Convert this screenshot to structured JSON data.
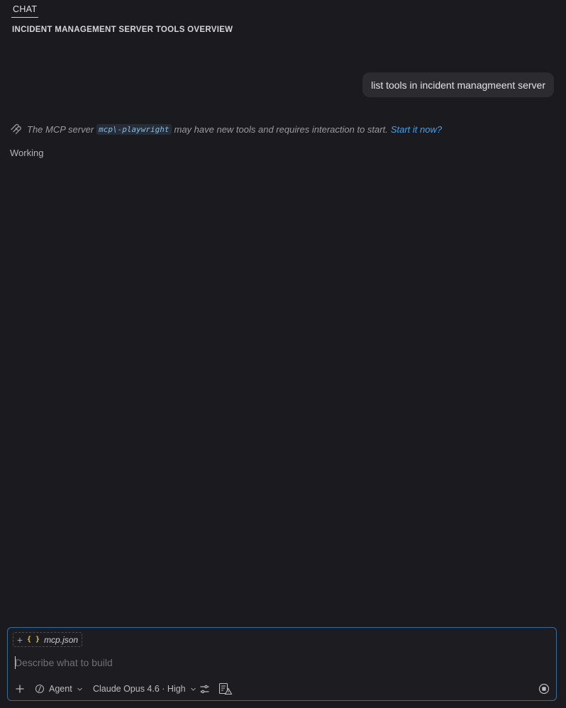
{
  "tabs": [
    {
      "label": "CHAT"
    }
  ],
  "header": {
    "title": "INCIDENT MANAGEMENT SERVER TOOLS OVERVIEW"
  },
  "messages": {
    "user": "list tools in incident managmeent server",
    "notice": {
      "prefix": "The MCP server",
      "server": "mcp\\-playwright",
      "suffix": "may have new tools and requires interaction to start.",
      "link": "Start it now?"
    },
    "status": "Working"
  },
  "composer": {
    "attachment": {
      "name": "mcp.json",
      "icon": "braces-icon"
    },
    "placeholder": "Describe what to build",
    "mode": "Agent",
    "model": "Claude Opus 4.6 · High"
  },
  "colors": {
    "background": "#1b1a1e",
    "accent": "#3a6e98",
    "link": "#4d9fe0"
  }
}
